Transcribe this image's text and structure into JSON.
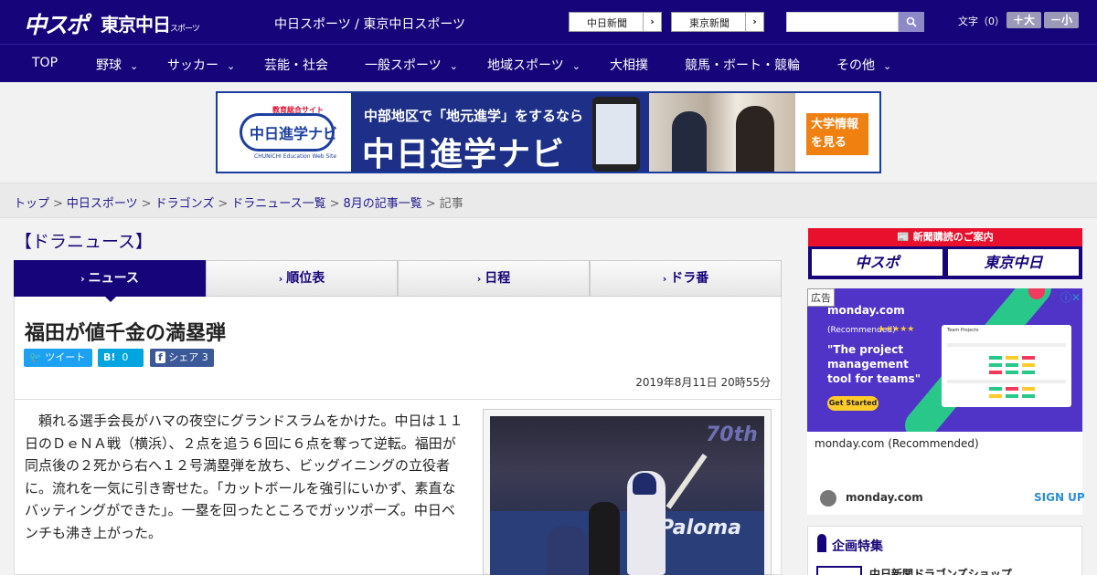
{
  "header": {
    "logo_chuspo": "中スポ",
    "logo_tokyo": "東京中日",
    "logo_tokyo_small": "スポーツ",
    "site_title": "中日スポーツ / 東京中日スポーツ",
    "paper_links": [
      {
        "label": "中日新聞",
        "arrow": "›"
      },
      {
        "label": "東京新聞",
        "arrow": "›"
      }
    ],
    "search_placeholder": "",
    "font_size_label": "文字（0）",
    "font_bigger": "＋大",
    "font_smaller": "－小"
  },
  "nav": {
    "items": [
      {
        "label": "TOP",
        "chevron": ""
      },
      {
        "label": "野球",
        "chevron": "⌄"
      },
      {
        "label": "サッカー",
        "chevron": "⌄"
      },
      {
        "label": "芸能・社会",
        "chevron": ""
      },
      {
        "label": "一般スポーツ",
        "chevron": "⌄"
      },
      {
        "label": "地域スポーツ",
        "chevron": "⌄"
      },
      {
        "label": "大相撲",
        "chevron": ""
      },
      {
        "label": "競馬・ボート・競輪",
        "chevron": ""
      },
      {
        "label": "その他",
        "chevron": "⌄"
      }
    ]
  },
  "banner": {
    "logo_top": "教育総合サイト",
    "logo_text": "中日進学ナビ",
    "logo_sub": "CHUNICHI Education Web Site",
    "line1": "中部地区で「地元進学」をするなら",
    "line2": "中日進学ナビ",
    "cta": "大学情報を見る"
  },
  "breadcrumb": {
    "items": [
      "トップ",
      "中日スポーツ",
      "ドラゴンズ",
      "ドラニュース一覧",
      "8月の記事一覧"
    ],
    "current": "記事",
    "separator": ">"
  },
  "section_title": "【ドラニュース】",
  "tabs": [
    {
      "label": "ニュース",
      "chevron": "›"
    },
    {
      "label": "順位表",
      "chevron": "›"
    },
    {
      "label": "日程",
      "chevron": "›"
    },
    {
      "label": "ドラ番",
      "chevron": "›"
    }
  ],
  "article": {
    "headline": "福田が値千金の満塁弾",
    "share": {
      "tweet": "ツイート",
      "hatena_label": "B!",
      "hatena_count": "0",
      "facebook": "シェア",
      "facebook_count": "3"
    },
    "date": "2019年8月11日 20時55分",
    "body": "頼れる選手会長がハマの夜空にグランドスラムをかけた。中日は１１日のＤｅＮＡ戦（横浜）、２点を追う６回に６点を奪って逆転。福田が同点後の２死から右へ１２号満塁弾を放ち、ビッグイニングの立役者に。流れを一気に引き寄せた。「カットボールを強引にいかず、素直なバッティングができた」。一塁を回ったところでガッツポーズ。中日ベンチも沸き上がった。",
    "photo_text": {
      "board": "Paloma",
      "logo": "70th"
    }
  },
  "sidebar": {
    "subscribe_header": "新聞購読のご案内",
    "subscribe_logos": [
      "中スポ",
      "東京中日"
    ],
    "ad": {
      "label": "広告",
      "info": "ⓘ✕",
      "brand": "monday.com",
      "recommended": "(Recommended)",
      "stars": "★★★★★",
      "tagline": "\"The project management tool for teams\"",
      "cta": "Get Started",
      "screen_title": "Team Projects",
      "name": "monday.com (Recommended)",
      "domain": "monday.com",
      "signup": "SIGN UP"
    },
    "feature_title": "企画特集",
    "feature_item": "中日新聞ドラゴンズショップ"
  },
  "colors": {
    "brand_navy": "#16057a",
    "accent_red": "#e8102d",
    "twitter": "#1da1f2",
    "hatena": "#00a4de",
    "facebook": "#3b5998"
  }
}
